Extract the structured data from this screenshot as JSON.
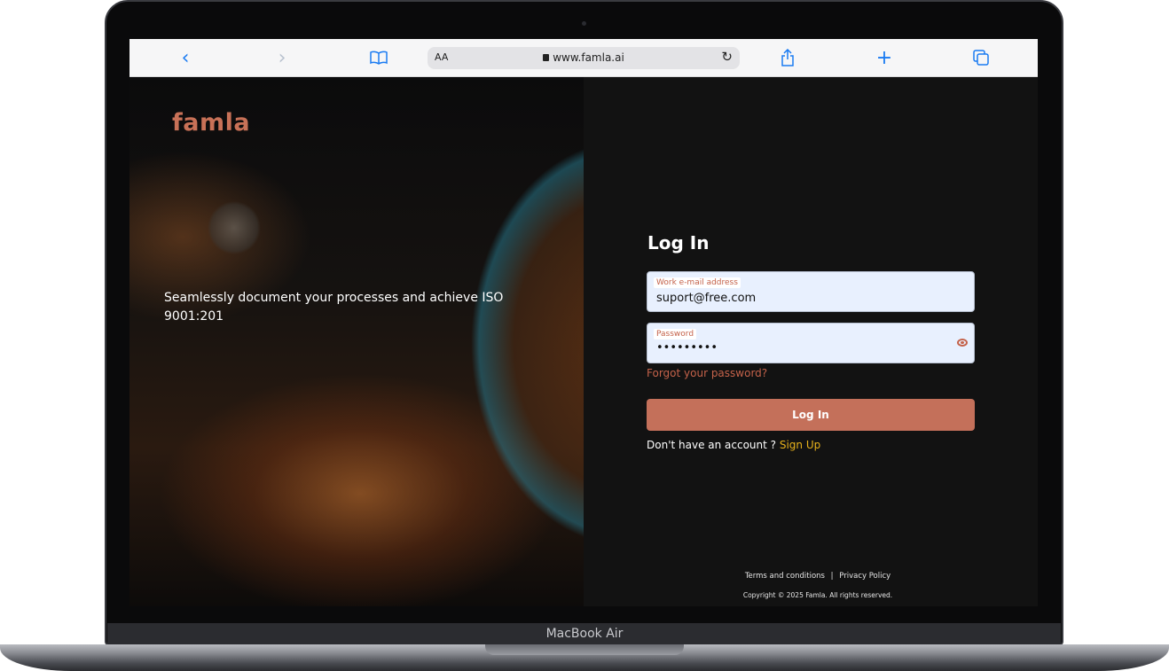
{
  "device": {
    "label": "MacBook Air"
  },
  "browser": {
    "text_size_button": "AA",
    "url": "www.famla.ai",
    "icons": [
      "back-icon",
      "forward-icon",
      "bookmarks-icon",
      "lock-icon",
      "reload-icon",
      "share-icon",
      "new-tab-icon",
      "tabs-icon"
    ]
  },
  "hero": {
    "logo": "famla",
    "tagline": "Seamlessly document your processes and achieve ISO 9001:201"
  },
  "login": {
    "title": "Log In",
    "email": {
      "label": "Work e-mail address",
      "value": "suport@free.com"
    },
    "password": {
      "label": "Password",
      "value": "•••••••••"
    },
    "forgot_link": "Forgot your password?",
    "submit_label": "Log In",
    "signup_prompt": "Don't have an account ? ",
    "signup_link": "Sign Up"
  },
  "footer": {
    "terms": "Terms and conditions",
    "separator": "|",
    "privacy": "Privacy Policy",
    "copyright": "Copyright © 2025 Famla. All rights reserved."
  },
  "colors": {
    "accent": "#c4705a",
    "signup_link": "#e8b21b",
    "background": "#121212",
    "field_bg": "#e8f0fe"
  }
}
